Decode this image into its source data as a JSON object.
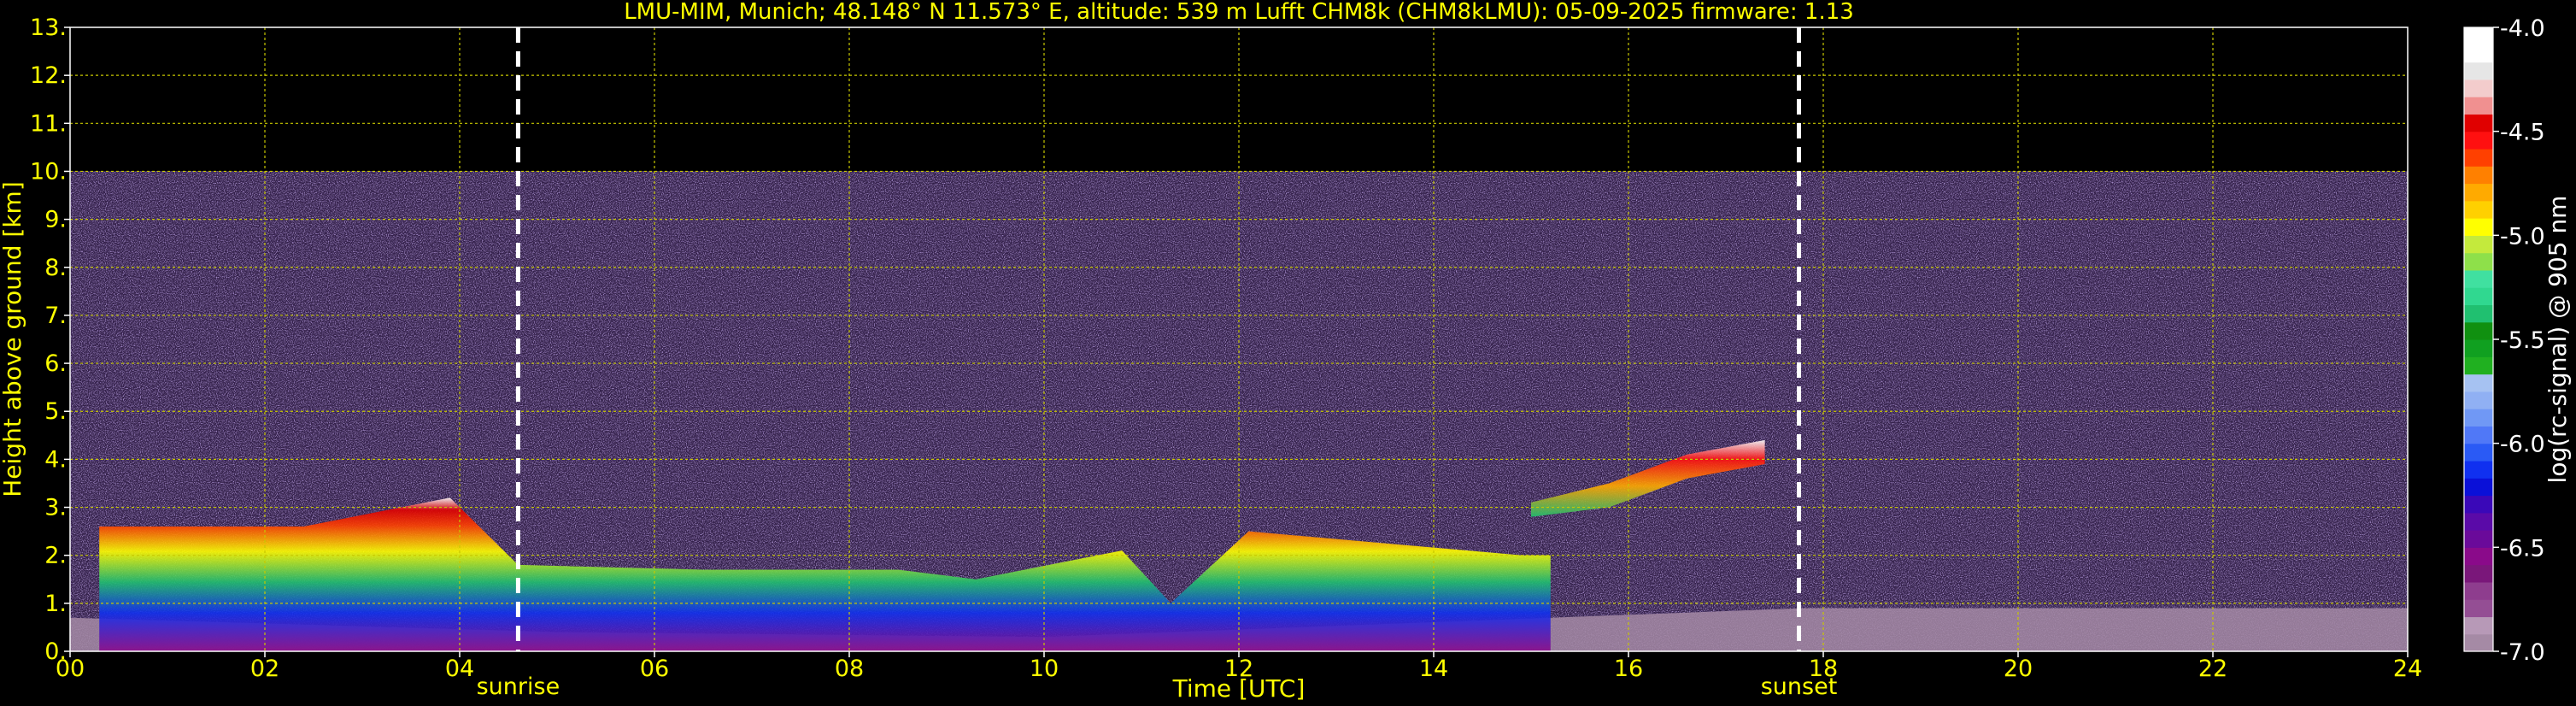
{
  "chart_data": {
    "type": "heatmap",
    "title": "LMU-MIM, Munich; 48.148° N 11.573° E, altitude: 539 m    Lufft CHM8k (CHM8kLMU): 05-09-2025    firmware: 1.13",
    "xlabel": "Time [UTC]",
    "ylabel": "Height above ground [km]",
    "xlim": [
      0,
      24
    ],
    "ylim": [
      0,
      13
    ],
    "x_ticks": [
      "00",
      "02",
      "04",
      "06",
      "08",
      "10",
      "12",
      "14",
      "16",
      "18",
      "20",
      "22",
      "24"
    ],
    "y_ticks": [
      "0.",
      "1.",
      "2.",
      "3.",
      "4.",
      "5.",
      "6.",
      "7.",
      "8.",
      "9.",
      "10.",
      "11.",
      "12.",
      "13."
    ],
    "grid": true,
    "data_top_km": 10,
    "sunrise": {
      "label": "sunrise",
      "time_h": 4.6
    },
    "sunset": {
      "label": "sunset",
      "time_h": 17.75
    },
    "colorbar": {
      "label": "log(rc-signal) @ 905 nm",
      "range": [
        -7.0,
        -4.0
      ],
      "ticks": [
        "-4.0",
        "-4.5",
        "-5.0",
        "-5.5",
        "-6.0",
        "-6.5",
        "-7.0"
      ],
      "colors": [
        "#a58aa5",
        "#b799b7",
        "#944e94",
        "#8e3d8e",
        "#7a177a",
        "#8a0a8a",
        "#6a0a9a",
        "#5a0aa8",
        "#3a08b8",
        "#0a10d8",
        "#1030f0",
        "#2a5af5",
        "#5078f7",
        "#7098f5",
        "#90b0f3",
        "#a6c2f2",
        "#20b020",
        "#10a020",
        "#109010",
        "#20c070",
        "#30d890",
        "#40e0a0",
        "#8ee04a",
        "#c4ea3c",
        "#ffff00",
        "#ffd000",
        "#ffaa00",
        "#ff8000",
        "#ff4000",
        "#ff1010",
        "#e00000",
        "#f09090",
        "#f3cccc",
        "#e6e6e6",
        "#ffffff",
        "#ffffff"
      ]
    },
    "layers": [
      {
        "name": "ground",
        "segments": [
          [
            0,
            0,
            0.7
          ],
          [
            5,
            0,
            0.4
          ],
          [
            10,
            0,
            0.3
          ],
          [
            17.8,
            0,
            0.9
          ],
          [
            24,
            0,
            0.9
          ]
        ]
      },
      {
        "name": "boundary-layer-night",
        "segments": [
          [
            0.3,
            0,
            2.6
          ],
          [
            2.4,
            0,
            2.6
          ],
          [
            3.9,
            0,
            3.2
          ],
          [
            4.6,
            0,
            1.8
          ],
          [
            6.5,
            0,
            1.7
          ],
          [
            8.5,
            0,
            1.7
          ],
          [
            9.3,
            0,
            1.5
          ],
          [
            10.8,
            0,
            2.1
          ],
          [
            11.3,
            0,
            1.0
          ],
          [
            12.1,
            0,
            2.5
          ],
          [
            14.9,
            0,
            2.0
          ],
          [
            15.2,
            0,
            2.0
          ]
        ]
      },
      {
        "name": "cloud-top",
        "segments": [
          [
            15.0,
            2.8,
            3.1
          ],
          [
            15.8,
            3.0,
            3.5
          ],
          [
            16.6,
            3.6,
            4.1
          ],
          [
            17.4,
            3.9,
            4.4
          ]
        ]
      }
    ]
  }
}
